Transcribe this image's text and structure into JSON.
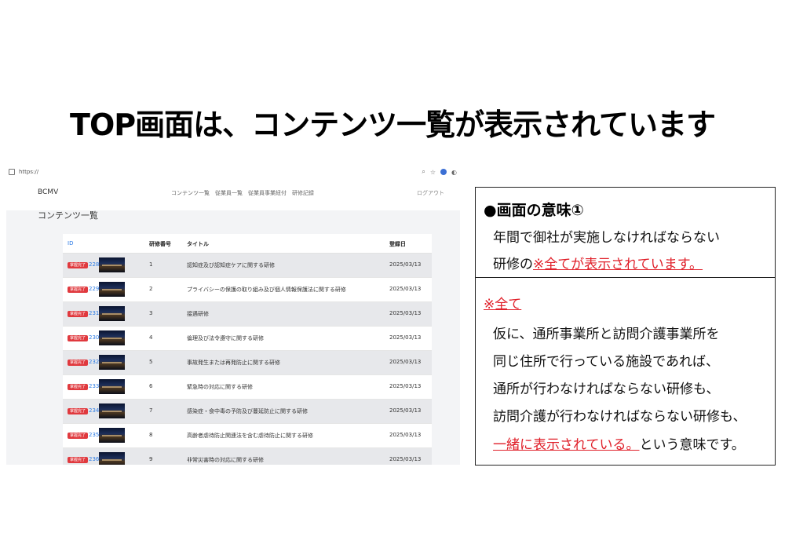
{
  "slide": {
    "title": "TOP画面は、コンテンツ一覧が表示されています"
  },
  "browser": {
    "url": "https://",
    "icons": [
      "search-icon",
      "star-icon",
      "profile-icon",
      "extension-icon"
    ]
  },
  "app": {
    "brand": "BCMV",
    "nav": [
      "コンテンツ一覧",
      "従業員一覧",
      "従業員事業紐付",
      "研修記録"
    ],
    "logout": "ログアウト",
    "page_title": "コンテンツ一覧"
  },
  "table": {
    "headers": {
      "id": "ID",
      "number": "研修番号",
      "title": "タイトル",
      "date": "登録日"
    },
    "badge_label": "掌握完了",
    "rows": [
      {
        "id": "228",
        "number": "1",
        "title": "認知症及び認知症ケアに関する研修",
        "date": "2025/03/13"
      },
      {
        "id": "229",
        "number": "2",
        "title": "プライバシーの保護の取り組み及び個人情報保護法に関する研修",
        "date": "2025/03/13"
      },
      {
        "id": "231",
        "number": "3",
        "title": "接遇研修",
        "date": "2025/03/13"
      },
      {
        "id": "230",
        "number": "4",
        "title": "倫理及び法令遵守に関する研修",
        "date": "2025/03/13"
      },
      {
        "id": "232",
        "number": "5",
        "title": "事故発生または再発防止に関する研修",
        "date": "2025/03/13"
      },
      {
        "id": "233",
        "number": "6",
        "title": "緊急時の対応に関する研修",
        "date": "2025/03/13"
      },
      {
        "id": "234",
        "number": "7",
        "title": "感染症・食中毒の予防及び蔓延防止に関する研修",
        "date": "2025/03/13"
      },
      {
        "id": "235",
        "number": "8",
        "title": "高齢者虐待防止関連法を含む虐待防止に関する研修",
        "date": "2025/03/13"
      },
      {
        "id": "236",
        "number": "9",
        "title": "非常災害時の対応に関する研修",
        "date": "2025/03/13"
      }
    ]
  },
  "info": {
    "heading": "●画面の意味①",
    "p1_line1": "年間で御社が実施しなければならない",
    "p1_line2_prefix": "研修の",
    "p1_line2_red": "※全てが表示されています。",
    "note_heading": "※全て",
    "p2_line1": "仮に、通所事業所と訪問介護事業所を",
    "p2_line2": "同じ住所で行っている施設であれば、",
    "p2_line3": "通所が行わなければならない研修も、",
    "p2_line4": "訪問介護が行わなければならない研修も、",
    "p2_line5_red": "一緒に表示されている。",
    "p2_line5_suffix": "という意味です。"
  },
  "colors": {
    "accent_red": "#e0202a",
    "link_blue": "#2c7be5"
  }
}
